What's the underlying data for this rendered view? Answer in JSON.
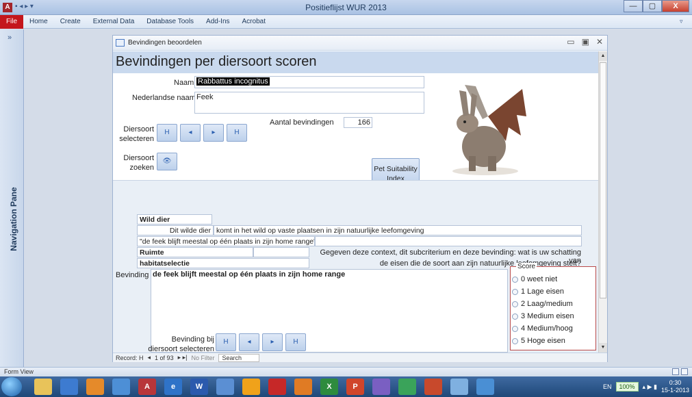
{
  "window": {
    "title": "Positieflijst WUR 2013",
    "minimize": "—",
    "maximize": "▢",
    "close": "X"
  },
  "ribbon": {
    "file": "File",
    "tabs": [
      "Home",
      "Create",
      "External Data",
      "Database Tools",
      "Add-Ins",
      "Acrobat"
    ]
  },
  "nav": {
    "toggle": "»",
    "label": "Navigation Pane"
  },
  "form": {
    "tab_title": "Bevindingen beoordelen",
    "heading": "Bevindingen per diersoort scoren",
    "naam_label": "Naam",
    "naam_value": "Rabbattus incognitus",
    "nl_naam_label": "Nederlandse naam",
    "nl_naam_value": "Feek",
    "aantal_label": "Aantal bevindingen",
    "aantal_value": "166",
    "diersoort_selecteren_label_1": "Diersoort",
    "diersoort_selecteren_label_2": "selecteren",
    "diersoort_zoeken_label_1": "Diersoort",
    "diersoort_zoeken_label_2": "zoeken",
    "pet_index_label_1": "Pet Suitability",
    "pet_index_label_2": "Index",
    "nav_first": "H",
    "nav_prev": "◂",
    "nav_next": "▸",
    "nav_last": "H",
    "search_icon": "binoculars-icon"
  },
  "detail": {
    "category": "Wild dier",
    "category_prefix": "Dit wilde dier",
    "category_text": "komt in het wild op vaste plaatsen in zijn natuurlijke leefomgeving",
    "quote": "\"de feek blijft meestal op één plaats in zijn home range\"",
    "criterion": "Ruimte",
    "subcriterion": "habitatselectie",
    "question_line1": "Gegeven deze context, dit subcriterium en deze bevinding:  wat is uw schatting van",
    "question_line2": "de eisen die de soort aan zijn natuurlijke leefomgeving stelt?",
    "bevinding_label": "Bevinding",
    "bevinding_value": "de feek blijft meestal op één plaats in zijn home range",
    "bevinding_select_1": "Bevinding bij",
    "bevinding_select_2": "diersoort selecteren"
  },
  "score": {
    "title": "Score",
    "options": [
      "0 weet niet",
      "1 Lage eisen",
      "2 Laag/medium",
      "3 Medium eisen",
      "4 Medium/hoog",
      "5 Hoge eisen"
    ]
  },
  "recordbar": {
    "record_label": "Record: H",
    "record_prev": "◂",
    "position": "1 of 93",
    "record_next": "▸ ▸|",
    "filter": "No Filter",
    "search": "Search"
  },
  "status": {
    "view": "Form View"
  },
  "taskbar": {
    "lang": "EN",
    "zoom": "100%",
    "time": "0:30",
    "date": "15-1-2013"
  },
  "colors": {
    "header_band": "#c9d9ee",
    "detail_band": "#e9eff6",
    "file_tab": "#c4161c",
    "score_border": "#b94a4a"
  }
}
